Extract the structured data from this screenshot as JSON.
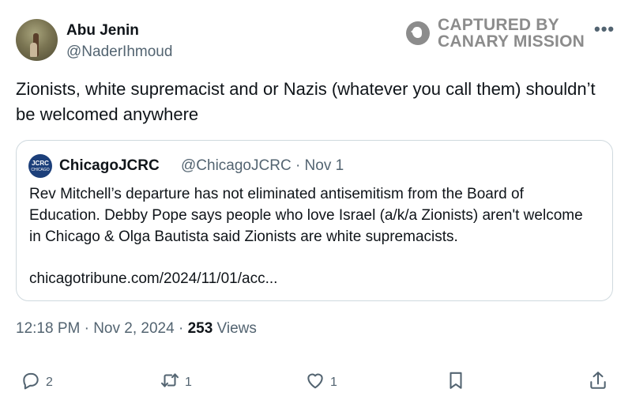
{
  "author": {
    "name": "Abu Jenin",
    "handle": "@NaderIhmoud"
  },
  "watermark": {
    "line1": "CAPTURED BY",
    "line2": "CANARY MISSION"
  },
  "menu_label": "•••",
  "tweet": {
    "text": "Zionists, white supremacist and or Nazis (whatever you call them) shouldn’t be welcomed anywhere"
  },
  "quote": {
    "avatar_text": "JCRC",
    "avatar_sub": "CHICAGO",
    "name": "ChicagoJCRC",
    "meta": "@ChicagoJCRC · Nov 1",
    "body": "Rev Mitchell’s departure has not eliminated antisemitism from the Board of Education. Debby Pope says people who love Israel (a/k/a Zionists) aren't welcome in Chicago & Olga Bautista said Zionists are white supremacists.",
    "link": "chicagotribune.com/2024/11/01/acc..."
  },
  "timestamp": {
    "time_date": "12:18 PM · Nov 2, 2024 · ",
    "views_count": "253",
    "views_label": " Views"
  },
  "actions": {
    "reply_count": "2",
    "retweet_count": "1",
    "like_count": "1"
  },
  "icons": {
    "reply": "reply-icon",
    "retweet": "retweet-icon",
    "like": "heart-icon",
    "bookmark": "bookmark-icon",
    "share": "share-icon",
    "watermark": "canary-logo-icon"
  },
  "colors": {
    "text": "#0f1419",
    "secondary": "#536471",
    "border": "#cfd9de",
    "watermark": "#8c8c8c"
  }
}
